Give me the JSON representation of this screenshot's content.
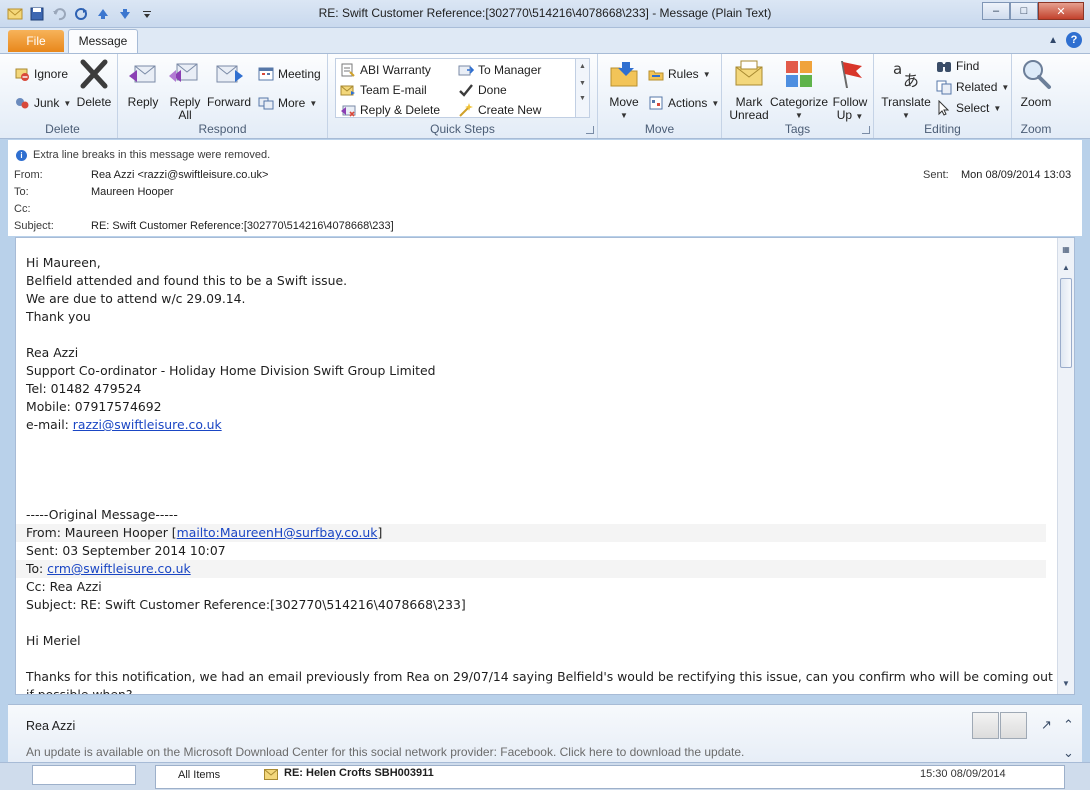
{
  "window": {
    "title": "RE: Swift Customer Reference:[302770\\514216\\4078668\\233]  -  Message (Plain Text)",
    "minimize": "–",
    "maximize": "□",
    "close": "✕"
  },
  "tabs": {
    "file": "File",
    "message": "Message"
  },
  "ribbon": {
    "delete_group": {
      "label": "Delete",
      "ignore": "Ignore",
      "junk": "Junk",
      "delete": "Delete"
    },
    "respond_group": {
      "label": "Respond",
      "reply": "Reply",
      "reply_all_1": "Reply",
      "reply_all_2": "All",
      "forward": "Forward",
      "meeting": "Meeting",
      "more": "More"
    },
    "quick_steps": {
      "label": "Quick Steps",
      "items": [
        "ABI Warranty",
        "Team E-mail",
        "Reply & Delete",
        "To Manager",
        "Done",
        "Create New"
      ]
    },
    "move_group": {
      "label": "Move",
      "move": "Move",
      "rules": "Rules",
      "actions": "Actions"
    },
    "tags_group": {
      "label": "Tags",
      "mark_unread_1": "Mark",
      "mark_unread_2": "Unread",
      "categorize": "Categorize",
      "follow_up_1": "Follow",
      "follow_up_2": "Up"
    },
    "editing_group": {
      "label": "Editing",
      "translate": "Translate",
      "find": "Find",
      "related": "Related",
      "select": "Select"
    },
    "zoom_group": {
      "label": "Zoom",
      "zoom": "Zoom"
    }
  },
  "header": {
    "info": "Extra line breaks in this message were removed.",
    "from_label": "From:",
    "from": "Rea Azzi <razzi@swiftleisure.co.uk>",
    "to_label": "To:",
    "to": "Maureen Hooper",
    "cc_label": "Cc:",
    "cc": "",
    "subject_label": "Subject:",
    "subject": "RE: Swift Customer Reference:[302770\\514216\\4078668\\233]",
    "sent_label": "Sent:",
    "sent": "Mon 08/09/2014 13:03"
  },
  "body": {
    "l1": "Hi Maureen,",
    "l2": "Belfield attended and found this to be a Swift issue.",
    "l3": "We are due to attend w/c 29.09.14.",
    "l4": "Thank you",
    "l5": "Rea Azzi",
    "l6": "Support Co-ordinator - Holiday Home Division Swift Group Limited",
    "l7": "Tel: 01482 479524",
    "l8": "Mobile: 07917574692",
    "l9_prefix": "e-mail: ",
    "l9_link": "razzi@swiftleisure.co.uk",
    "orig": "-----Original Message-----",
    "of_prefix": "From: Maureen Hooper [",
    "of_link": "mailto:MaureenH@surfbay.co.uk",
    "of_suffix": "]",
    "os": "Sent: 03 September 2014 10:07",
    "ot_prefix": "To: ",
    "ot_link": "crm@swiftleisure.co.uk",
    "oc": "Cc: Rea Azzi",
    "osub": "Subject: RE: Swift Customer Reference:[302770\\514216\\4078668\\233]",
    "hi": "Hi Meriel",
    "p1": "Thanks for this notification, we had an email previously from Rea on 29/07/14 saying Belfield's would be rectifying this issue, can you confirm who will be coming out and",
    "p2": "if possible when?"
  },
  "people": {
    "name": "Rea Azzi",
    "update": "An update is available on the Microsoft Download Center for this social network provider: Facebook. Click here to download the update."
  },
  "strip": {
    "all_items": "All Items",
    "subject": "RE: Helen Crofts SBH003911",
    "date": "15:30  08/09/2014"
  },
  "colors": {
    "accent_file": "#e8871b",
    "link": "#1a46c4",
    "ribbon_bg": "#e3ecf7"
  }
}
